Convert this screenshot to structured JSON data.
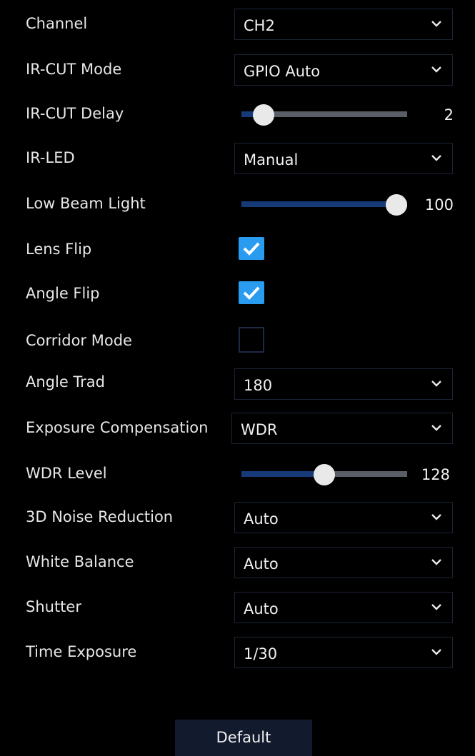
{
  "colors": {
    "background": "#000000",
    "accent": "#2a9cf0",
    "slider_fill": "#163a78",
    "slider_track": "#5a5e66",
    "text": "#e6e6e6",
    "button_bg": "#121a2e"
  },
  "channel": {
    "label": "Channel",
    "value": "CH2",
    "icon": "chevron-down-icon"
  },
  "ircut_mode": {
    "label": "IR-CUT Mode",
    "value": "GPIO Auto",
    "icon": "chevron-down-icon"
  },
  "ircut_delay": {
    "label": "IR-CUT Delay",
    "value": "2",
    "fraction": 0.08
  },
  "ir_led": {
    "label": "IR-LED",
    "value": "Manual",
    "icon": "chevron-down-icon"
  },
  "low_beam_light": {
    "label": "Low Beam Light",
    "value": "100",
    "fraction": 1.0
  },
  "lens_flip": {
    "label": "Lens Flip",
    "checked": true
  },
  "angle_flip": {
    "label": "Angle Flip",
    "checked": true
  },
  "corridor_mode": {
    "label": "Corridor Mode",
    "checked": false
  },
  "angle_trad": {
    "label": "Angle Trad",
    "value": "180",
    "icon": "chevron-down-icon"
  },
  "exposure_compensation": {
    "label": "Exposure Compensation",
    "value": "WDR",
    "icon": "chevron-down-icon"
  },
  "wdr_level": {
    "label": "WDR Level",
    "value": "128",
    "fraction": 0.5
  },
  "noise_reduction": {
    "label": "3D Noise Reduction",
    "value": "Auto",
    "icon": "chevron-down-icon"
  },
  "white_balance": {
    "label": "White Balance",
    "value": "Auto",
    "icon": "chevron-down-icon"
  },
  "shutter": {
    "label": "Shutter",
    "value": "Auto",
    "icon": "chevron-down-icon"
  },
  "time_exposure": {
    "label": "Time Exposure",
    "value": "1/30",
    "icon": "chevron-down-icon"
  },
  "footer": {
    "default_label": "Default"
  }
}
